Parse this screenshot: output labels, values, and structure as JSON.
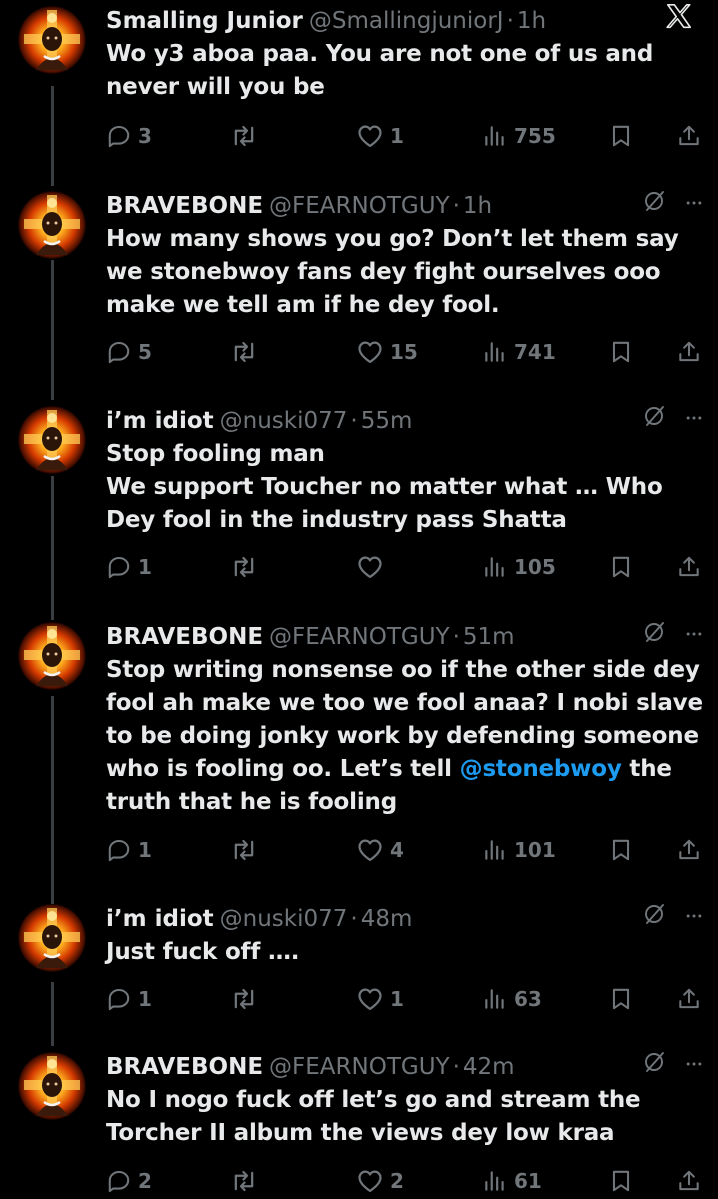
{
  "platform_logo": "X",
  "icons": {
    "reply": "speech-bubble-icon",
    "retweet": "retweet-arrows-icon",
    "like": "heart-icon",
    "views": "bar-chart-icon",
    "bookmark": "bookmark-icon",
    "share": "share-upload-icon",
    "grok": "grok-slash-circle-icon",
    "more": "more-dots-icon"
  },
  "colors": {
    "background": "#000000",
    "text": "#e7e9ea",
    "muted": "#71767b",
    "mention": "#1d9bf0"
  },
  "tweets": [
    {
      "name": "Smalling Junior",
      "handle": "@SmallingjuniorJ",
      "dot": "·",
      "time": "1h",
      "lines": [
        "Wo y3 aboa paa. You are not one of us and",
        "never will you be"
      ],
      "replies": "3",
      "retweets": "",
      "likes": "1",
      "views": "755"
    },
    {
      "name": "BRAVEBONE",
      "handle": "@FEARNOTGUY",
      "dot": "·",
      "time": "1h",
      "lines": [
        "How many shows you go? Don’t let them say",
        "we stonebwoy fans dey fight ourselves ooo",
        "make we tell am if he dey fool."
      ],
      "replies": "5",
      "retweets": "",
      "likes": "15",
      "views": "741"
    },
    {
      "name": "i’m idiot",
      "handle": "@nuski077",
      "dot": "·",
      "time": "55m",
      "lines": [
        "Stop fooling man",
        "We support Toucher no matter what … Who",
        "Dey fool in the industry pass Shatta"
      ],
      "replies": "1",
      "retweets": "",
      "likes": "",
      "views": "105"
    },
    {
      "name": "BRAVEBONE",
      "handle": "@FEARNOTGUY",
      "dot": "·",
      "time": "51m",
      "lines": [
        "Stop writing nonsense oo if the other side dey",
        "fool ah make we too we fool anaa? I nobi slave",
        "to be doing jonky work by defending someone"
      ],
      "line4_pre": "who is fooling oo. Let’s tell ",
      "mention": "@stonebwoy",
      "line4_post": " the",
      "line5": "truth that he is fooling",
      "replies": "1",
      "retweets": "",
      "likes": "4",
      "views": "101"
    },
    {
      "name": "i’m idiot",
      "handle": "@nuski077",
      "dot": "·",
      "time": "48m",
      "lines": [
        "Just fuck off …."
      ],
      "replies": "1",
      "retweets": "",
      "likes": "1",
      "views": "63"
    },
    {
      "name": "BRAVEBONE",
      "handle": "@FEARNOTGUY",
      "dot": "·",
      "time": "42m",
      "lines": [
        "No I nogo fuck off let’s go and stream the",
        "Torcher II album the views dey low kraa"
      ],
      "replies": "2",
      "retweets": "",
      "likes": "2",
      "views": "61"
    }
  ]
}
